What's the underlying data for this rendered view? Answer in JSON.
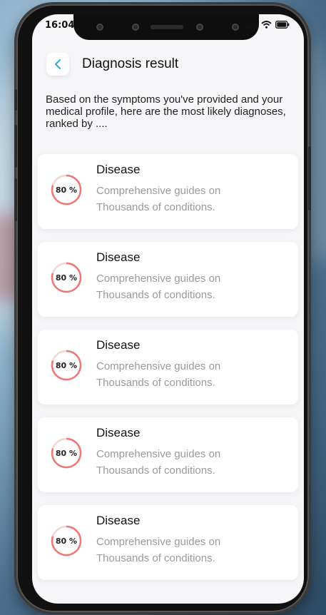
{
  "status_bar": {
    "time": "16:04"
  },
  "header": {
    "title": "Diagnosis result"
  },
  "intro": "Based on the symptoms you've provided and your medical profile, here are the most likely diagnoses, ranked by ....",
  "colors": {
    "accent": "#2fa9d8",
    "ring": "#f07874"
  },
  "icons": {
    "back": "chevron-left-icon",
    "signal": "signal-icon",
    "wifi": "wifi-icon",
    "battery": "battery-icon"
  },
  "diagnoses": [
    {
      "percent": "80 %",
      "level": 0.8,
      "title": "Disease",
      "description": "Comprehensive guides on Thousands  of conditions."
    },
    {
      "percent": "80 %",
      "level": 0.8,
      "title": "Disease",
      "description": "Comprehensive guides on Thousands  of conditions."
    },
    {
      "percent": "80 %",
      "level": 0.8,
      "title": "Disease",
      "description": "Comprehensive guides on Thousands  of conditions."
    },
    {
      "percent": "80 %",
      "level": 0.8,
      "title": "Disease",
      "description": "Comprehensive guides on Thousands  of conditions."
    },
    {
      "percent": "80 %",
      "level": 0.8,
      "title": "Disease",
      "description": "Comprehensive guides on Thousands  of conditions."
    }
  ]
}
